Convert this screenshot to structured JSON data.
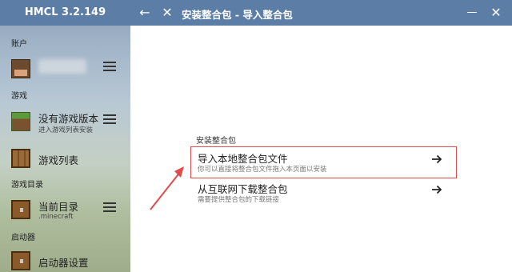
{
  "app": {
    "title": "HMCL 3.2.149"
  },
  "titlebar": {
    "page_title": "安装整合包 - 导入整合包",
    "back_glyph": "←",
    "close_glyph": "✕",
    "minimize_glyph": "—",
    "window_close_glyph": "✕"
  },
  "sidebar": {
    "account_section": "账户",
    "game_section": "游戏",
    "no_game_version": {
      "title": "没有游戏版本",
      "subtitle": "进入游戏列表安装"
    },
    "game_list": {
      "title": "游戏列表"
    },
    "directory_section": "游戏目录",
    "current_directory": {
      "title": "当前目录",
      "subtitle": ".minecraft"
    },
    "launcher_section": "启动器",
    "launcher_settings": {
      "title": "启动器设置"
    }
  },
  "main": {
    "section_label": "安装整合包",
    "options": [
      {
        "title": "导入本地整合包文件",
        "subtitle": "你可以直接将整合包文件拖入本页面以安装",
        "arrow": "→"
      },
      {
        "title": "从互联网下载整合包",
        "subtitle": "需要提供整合包的下载链接",
        "arrow": "→"
      }
    ]
  },
  "colors": {
    "accent": "#5c7ea6",
    "highlight": "#e24b4b"
  }
}
